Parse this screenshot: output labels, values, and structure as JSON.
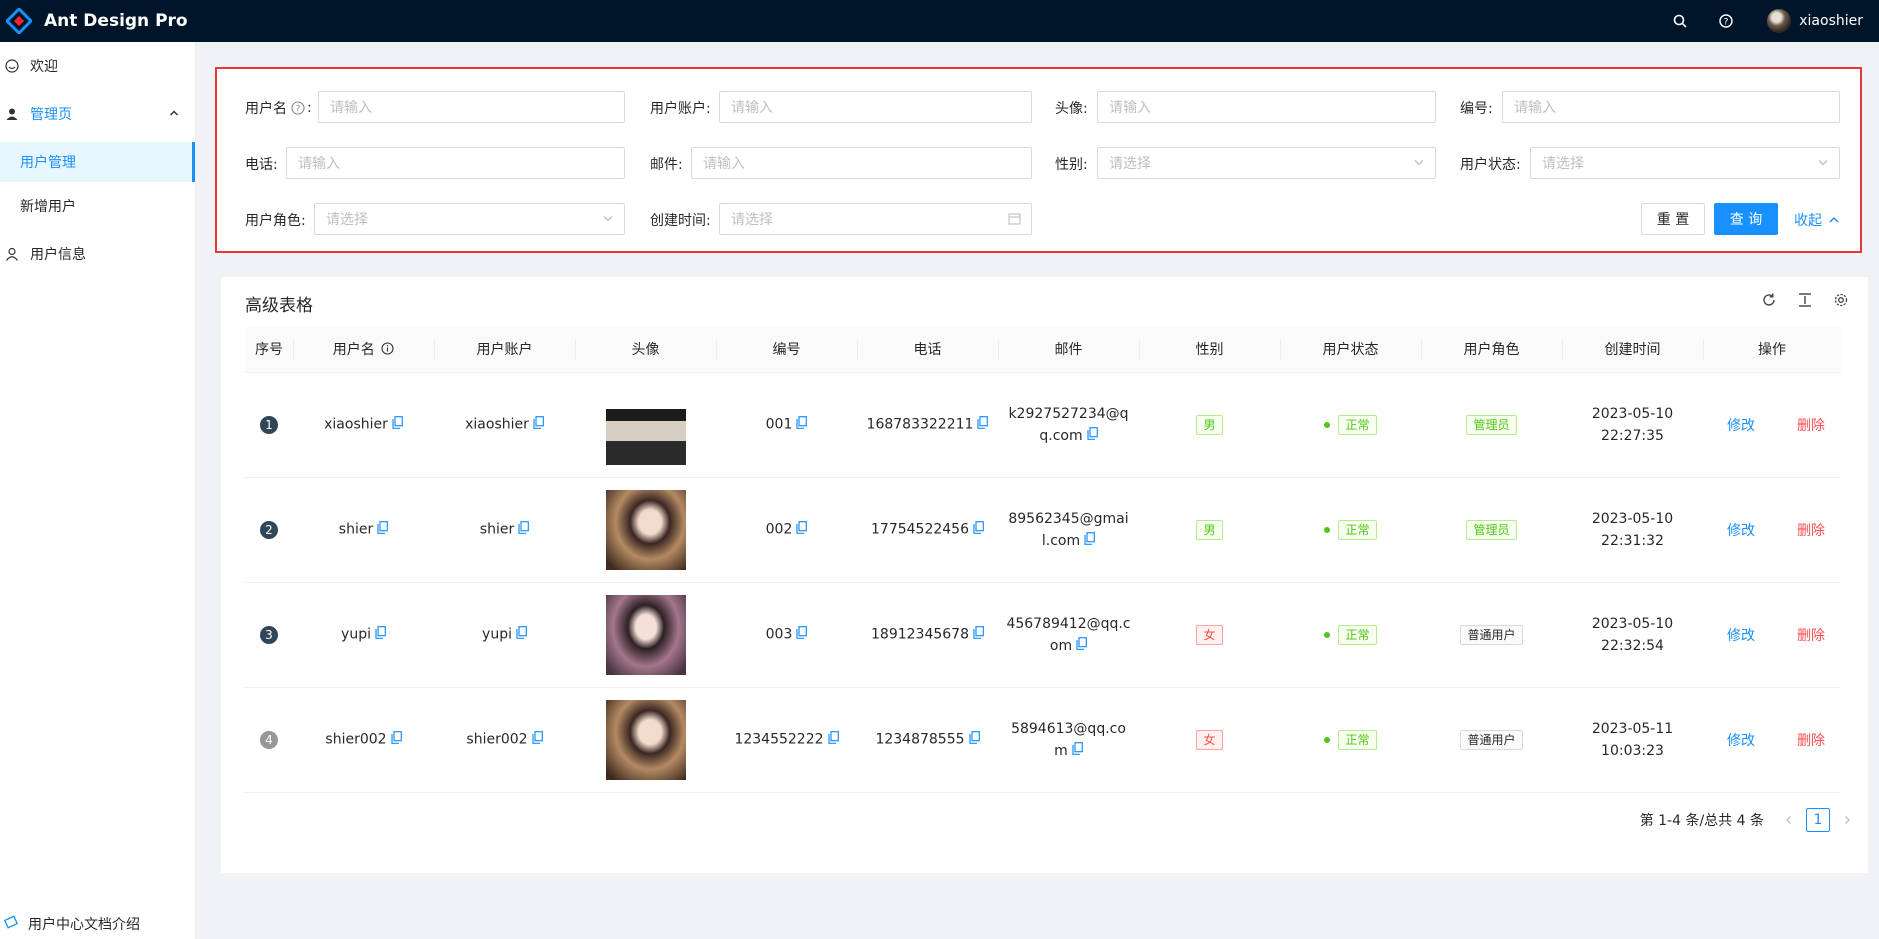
{
  "header": {
    "app_title": "Ant Design Pro",
    "user_name": "xiaoshier",
    "colors": {
      "bg": "#001529",
      "primary": "#1890ff"
    }
  },
  "sidebar": {
    "items": [
      {
        "label": "欢迎",
        "icon": "smile-icon"
      },
      {
        "label": "管理页",
        "icon": "crown-icon"
      },
      {
        "label": "用户管理"
      },
      {
        "label": "新增用户"
      },
      {
        "label": "用户信息",
        "icon": "user-icon"
      }
    ],
    "bottom_link": "用户中心文档介绍"
  },
  "search": {
    "fields": {
      "username": {
        "label": "用户名",
        "placeholder": "请输入"
      },
      "account": {
        "label": "用户账户:",
        "placeholder": "请输入"
      },
      "avatar": {
        "label": "头像:",
        "placeholder": "请输入"
      },
      "code": {
        "label": "编号:",
        "placeholder": "请输入"
      },
      "phone": {
        "label": "电话:",
        "placeholder": "请输入"
      },
      "email": {
        "label": "邮件:",
        "placeholder": "请输入"
      },
      "gender": {
        "label": "性别:",
        "placeholder": "请选择"
      },
      "status": {
        "label": "用户状态:",
        "placeholder": "请选择"
      },
      "role": {
        "label": "用户角色:",
        "placeholder": "请选择"
      },
      "created": {
        "label": "创建时间:",
        "placeholder": "请选择"
      }
    },
    "reset_label": "重 置",
    "query_label": "查 询",
    "collapse_label": "收起"
  },
  "table": {
    "title": "高级表格",
    "columns": [
      "序号",
      "用户名",
      "用户账户",
      "头像",
      "编号",
      "电话",
      "邮件",
      "性别",
      "用户状态",
      "用户角色",
      "创建时间",
      "操作"
    ],
    "rows": [
      {
        "index": "1",
        "username": "xiaoshier",
        "account": "xiaoshier",
        "code": "001",
        "phone": "168783322211",
        "email": "k2927527234@qq.com",
        "gender": "男",
        "status": "正常",
        "role": "管理员",
        "created": "2023-05-10 22:27:35",
        "edit": "修改",
        "delete": "删除"
      },
      {
        "index": "2",
        "username": "shier",
        "account": "shier",
        "code": "002",
        "phone": "17754522456",
        "email": "89562345@gmail.com",
        "gender": "男",
        "status": "正常",
        "role": "管理员",
        "created": "2023-05-10 22:31:32",
        "edit": "修改",
        "delete": "删除"
      },
      {
        "index": "3",
        "username": "yupi",
        "account": "yupi",
        "code": "003",
        "phone": "18912345678",
        "email": "456789412@qq.com",
        "gender": "女",
        "status": "正常",
        "role": "普通用户",
        "created": "2023-05-10 22:32:54",
        "edit": "修改",
        "delete": "删除"
      },
      {
        "index": "4",
        "username": "shier002",
        "account": "shier002",
        "code": "1234552222",
        "phone": "1234878555",
        "email": "5894613@qq.com",
        "gender": "女",
        "status": "正常",
        "role": "普通用户",
        "created": "2023-05-11 10:03:23",
        "edit": "修改",
        "delete": "删除"
      }
    ]
  },
  "pagination": {
    "summary": "第 1-4 条/总共 4 条",
    "current": "1"
  }
}
